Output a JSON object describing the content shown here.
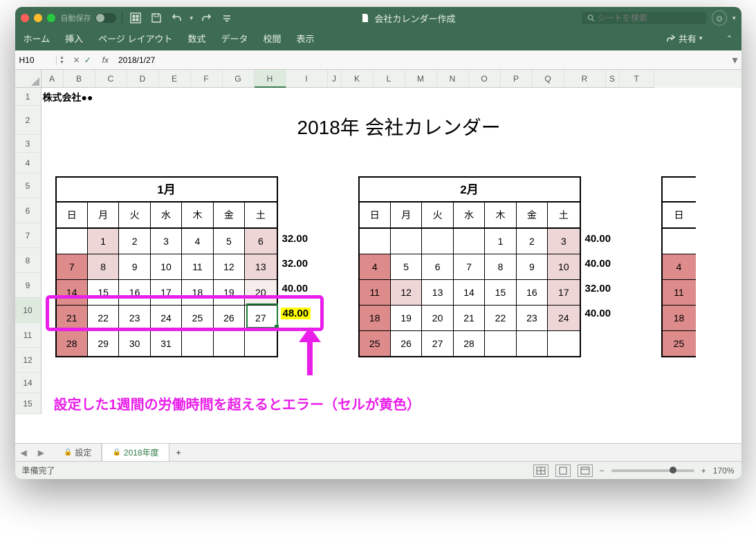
{
  "titlebar": {
    "autosave_label": "自動保存",
    "doc_title": "会社カレンダー作成",
    "search_placeholder": "シートを検索"
  },
  "ribbon": {
    "tabs": [
      "ホーム",
      "挿入",
      "ページ レイアウト",
      "数式",
      "データ",
      "校閲",
      "表示"
    ],
    "share": "共有"
  },
  "formula_bar": {
    "cell_ref": "H10",
    "fx_label": "fx",
    "formula": "2018/1/27"
  },
  "columns": [
    "A",
    "B",
    "C",
    "D",
    "E",
    "F",
    "G",
    "H",
    "I",
    "J",
    "K",
    "L",
    "M",
    "N",
    "O",
    "P",
    "Q",
    "R",
    "S",
    "T"
  ],
  "active_col": "H",
  "rows": {
    "visible": [
      1,
      2,
      3,
      4,
      5,
      6,
      7,
      8,
      9,
      10,
      11,
      12,
      14,
      15
    ],
    "heights": {
      "1": 26,
      "2": 42,
      "3": 26,
      "4": 30,
      "5": 36,
      "6": 36,
      "7": 36,
      "8": 36,
      "9": 36,
      "10": 36,
      "11": 36,
      "12": 36,
      "14": 30,
      "15": 30
    },
    "selected": 10
  },
  "sheet": {
    "company": "株式会社●●",
    "title": "2018年 会社カレンダー"
  },
  "weekdays": [
    "日",
    "月",
    "火",
    "水",
    "木",
    "金",
    "土"
  ],
  "months": {
    "jan": {
      "label": "1月",
      "weeks": [
        [
          "",
          "1",
          "2",
          "3",
          "4",
          "5",
          "6"
        ],
        [
          "7",
          "8",
          "9",
          "10",
          "11",
          "12",
          "13"
        ],
        [
          "14",
          "15",
          "16",
          "17",
          "18",
          "19",
          "20"
        ],
        [
          "21",
          "22",
          "23",
          "24",
          "25",
          "26",
          "27"
        ],
        [
          "28",
          "29",
          "30",
          "31",
          "",
          "",
          ""
        ]
      ],
      "sums": [
        "32.00",
        "32.00",
        "40.00",
        "48.00",
        ""
      ]
    },
    "feb": {
      "label": "2月",
      "weeks": [
        [
          "",
          "",
          "",
          "",
          "1",
          "2",
          "3"
        ],
        [
          "4",
          "5",
          "6",
          "7",
          "8",
          "9",
          "10"
        ],
        [
          "11",
          "12",
          "13",
          "14",
          "15",
          "16",
          "17"
        ],
        [
          "18",
          "19",
          "20",
          "21",
          "22",
          "23",
          "24"
        ],
        [
          "25",
          "26",
          "27",
          "28",
          "",
          "",
          ""
        ]
      ],
      "sums": [
        "40.00",
        "40.00",
        "32.00",
        "40.00",
        ""
      ]
    },
    "mar_stub": {
      "day0": "日",
      "rows": [
        "",
        "4",
        "11",
        "18",
        "25"
      ]
    }
  },
  "annotation": "設定した1週間の労働時間を超えるとエラー（セルが黄色）",
  "tabs": {
    "t1": "設定",
    "t2": "2018年度"
  },
  "status": {
    "ready": "準備完了",
    "zoom": "170%"
  }
}
